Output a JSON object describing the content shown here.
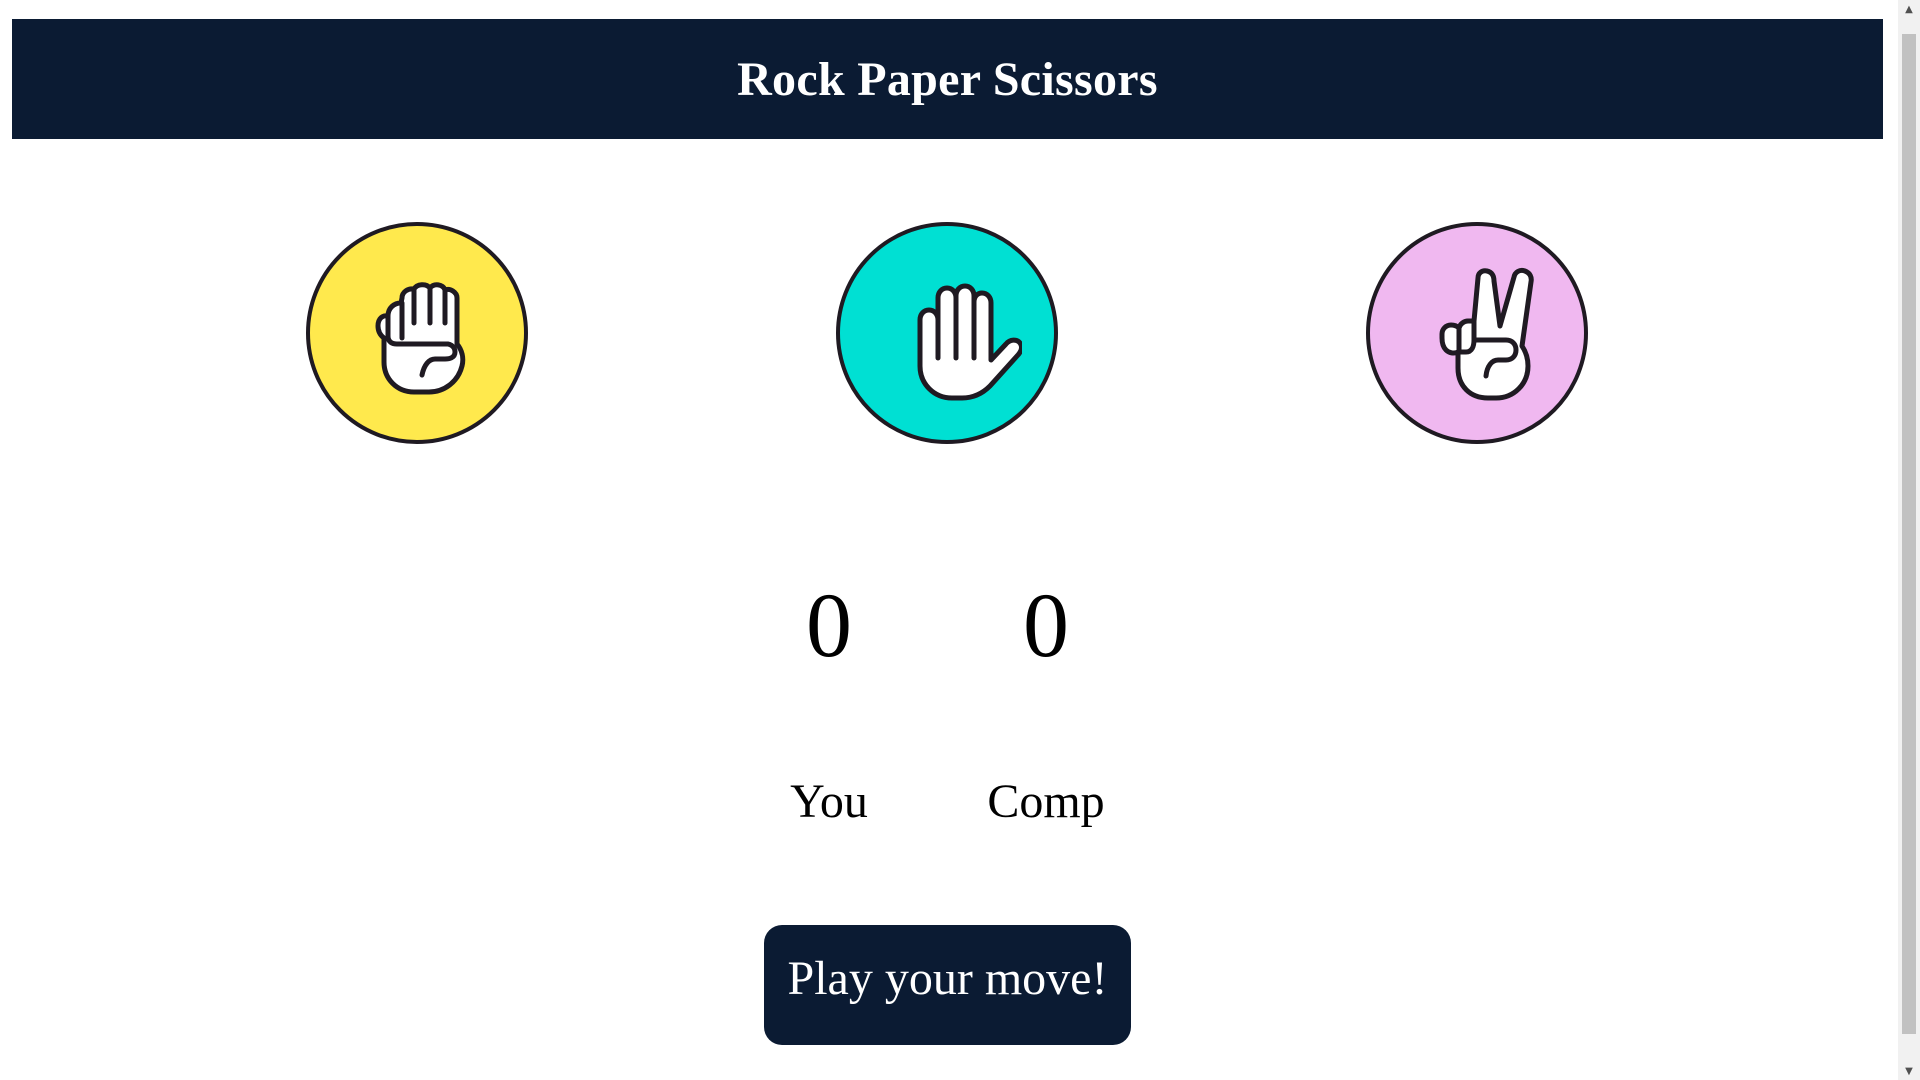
{
  "header": {
    "title": "Rock Paper Scissors"
  },
  "choices": [
    {
      "id": "rock",
      "icon": "fist-icon",
      "color": "#ffe94d"
    },
    {
      "id": "paper",
      "icon": "open-hand-icon",
      "color": "#00e0d3"
    },
    {
      "id": "scissors",
      "icon": "peace-hand-icon",
      "color": "#f0b8f0"
    }
  ],
  "scoreboard": {
    "user_score": "0",
    "comp_score": "0",
    "user_label": "You",
    "comp_label": "Comp"
  },
  "message": {
    "text": "Play your move!"
  },
  "colors": {
    "navy": "#0b1b33",
    "outline": "#1f1a22",
    "page_bg": "#ffffff"
  }
}
